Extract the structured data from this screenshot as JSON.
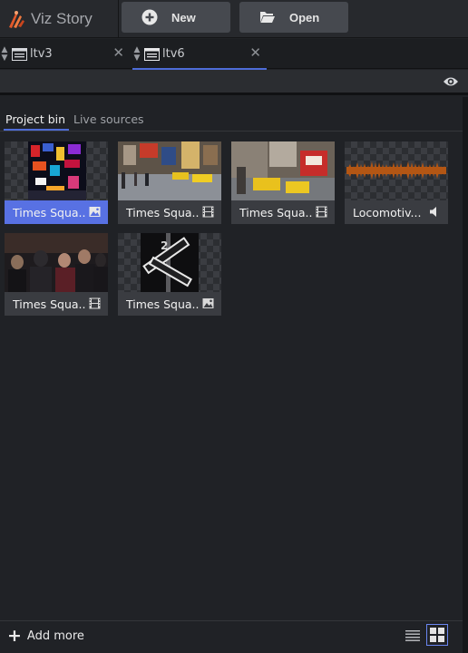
{
  "app": {
    "name": "Viz Story",
    "brand_color": "#e2592b"
  },
  "toolbar": {
    "new_label": "New",
    "open_label": "Open"
  },
  "tabs": [
    {
      "label": "ltv3",
      "close": "✕"
    },
    {
      "label": "ltv6",
      "close": "✕",
      "active": true
    }
  ],
  "bin": {
    "tabs": [
      {
        "label": "Project bin",
        "active": true
      },
      {
        "label": "Live sources"
      }
    ],
    "items": [
      {
        "label": "Times Squa...",
        "type": "image-icon",
        "selected": true
      },
      {
        "label": "Times Squa...",
        "type": "film-icon"
      },
      {
        "label": "Times Squa...",
        "type": "film-icon"
      },
      {
        "label": "Locomotiv...",
        "type": "speaker-icon"
      },
      {
        "label": "Times Squa...",
        "type": "film-icon"
      },
      {
        "label": "Times Squa...",
        "type": "image-icon"
      }
    ]
  },
  "footer": {
    "add_more_label": "Add more",
    "view_mode": "grid"
  },
  "colors": {
    "accent": "#5871e3",
    "tab_underline": "#4e6cd8",
    "waveform": "#b35614"
  }
}
